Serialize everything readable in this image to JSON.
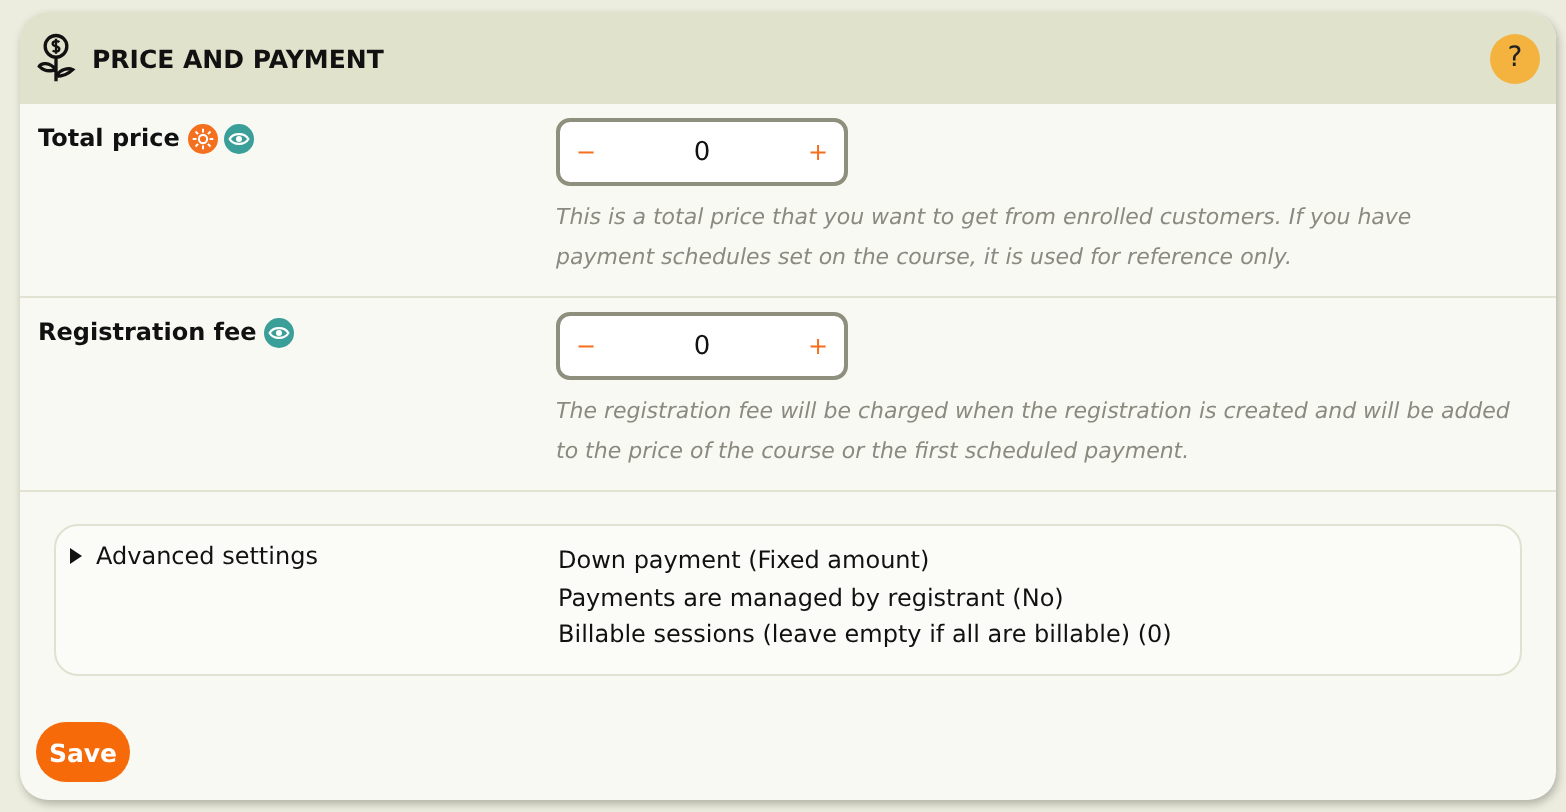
{
  "header": {
    "title": "PRICE AND PAYMENT",
    "help": "?"
  },
  "fields": [
    {
      "label": "Total price",
      "badges": [
        {
          "kind": "sun"
        },
        {
          "kind": "eye"
        }
      ],
      "minus": "−",
      "value": "0",
      "plus": "+",
      "hint": "This is a total price that you want to get from enrolled customers. If you have payment schedules set on the course, it is used for reference only."
    },
    {
      "label": "Registration fee",
      "badges": [
        {
          "kind": "eye"
        }
      ],
      "minus": "−",
      "value": "0",
      "plus": "+",
      "hint": "The registration fee will be charged when the registration is created and will be added to the price of the course or the first scheduled payment."
    }
  ],
  "advanced": {
    "label": "Advanced settings",
    "expanded": false,
    "items": [
      "Down payment (Fixed amount)",
      "Payments are managed by registrant (No)",
      "Billable sessions (leave empty if all are billable) (0)"
    ]
  },
  "save": "Save"
}
